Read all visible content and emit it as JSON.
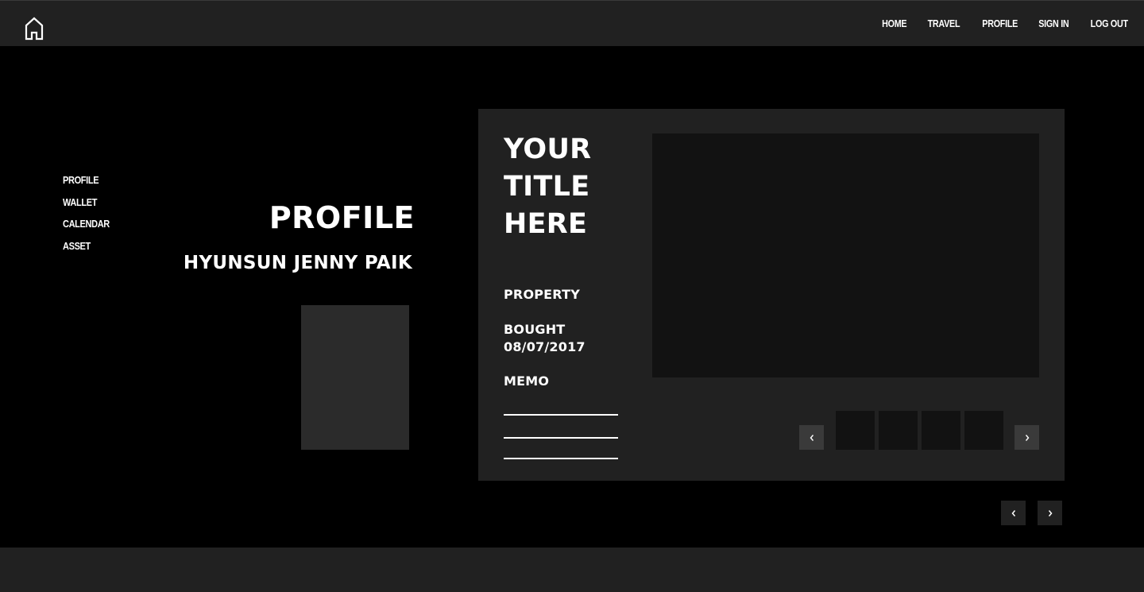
{
  "nav": {
    "items": [
      "HOME",
      "TRAVEL",
      "PROFILE",
      "SIGN IN",
      "LOG OUT"
    ]
  },
  "sidebar": {
    "items": [
      "PROFILE",
      "WALLET",
      "CALENDAR",
      "ASSET"
    ]
  },
  "profile": {
    "title": "PROFILE",
    "name": "HYUNSUN JENNY PAIK"
  },
  "card": {
    "title_line1": "YOUR",
    "title_line2": "TITLE",
    "title_line3": "HERE",
    "property_label": "PROPERTY",
    "bought_label": "BOUGHT",
    "bought_date": "08/07/2017",
    "memo_label": "MEMO"
  },
  "icons": {
    "logo": "house-outline-icon",
    "prev": "chevron-left-icon",
    "next": "chevron-right-icon"
  },
  "colors": {
    "background": "#000000",
    "topbar": "#212121",
    "card": "#212121",
    "image_placeholder": "#121212",
    "photo_placeholder": "#2b2b2b"
  }
}
